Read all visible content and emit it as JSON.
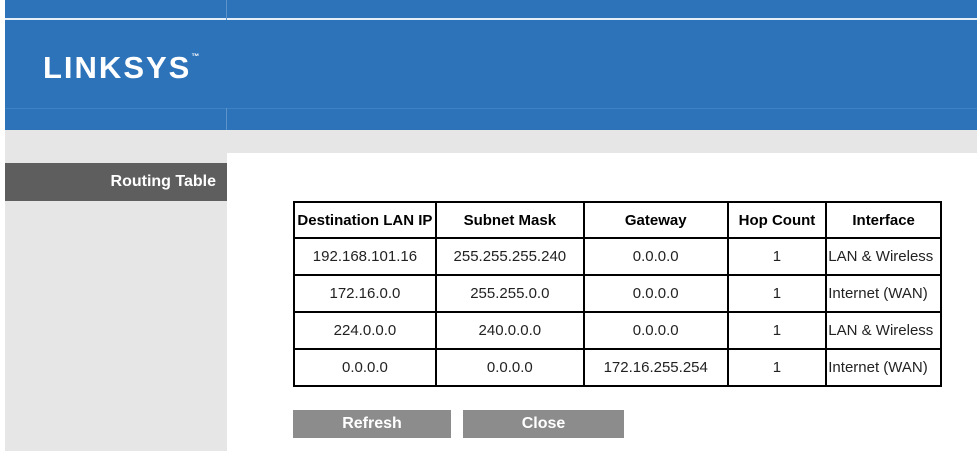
{
  "header": {
    "logo_text": "LINKSYS",
    "trademark": "™"
  },
  "sidebar": {
    "section_title": "Routing Table"
  },
  "table": {
    "columns": [
      "Destination LAN IP",
      "Subnet Mask",
      "Gateway",
      "Hop Count",
      "Interface"
    ],
    "rows": [
      [
        "192.168.101.16",
        "255.255.255.240",
        "0.0.0.0",
        "1",
        "LAN & Wireless"
      ],
      [
        "172.16.0.0",
        "255.255.0.0",
        "0.0.0.0",
        "1",
        "Internet (WAN)"
      ],
      [
        "224.0.0.0",
        "240.0.0.0",
        "0.0.0.0",
        "1",
        "LAN & Wireless"
      ],
      [
        "0.0.0.0",
        "0.0.0.0",
        "172.16.255.254",
        "1",
        "Internet (WAN)"
      ]
    ]
  },
  "buttons": {
    "refresh": "Refresh",
    "close": "Close"
  },
  "colors": {
    "header_blue": "#2d73b9",
    "sidebar_grey": "#e6e6e6",
    "section_dark": "#5e5e5e",
    "button_grey": "#8c8c8c"
  }
}
